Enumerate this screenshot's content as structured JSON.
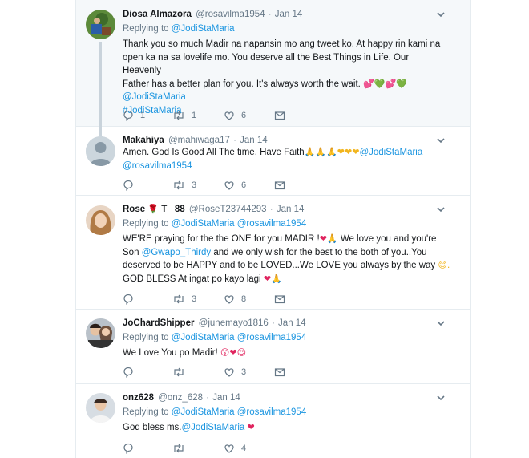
{
  "tweets": [
    {
      "name": "Diosa Almazora",
      "handle": "@rosavilma1954",
      "time": "Jan 14",
      "replying_label": "Replying to",
      "replying_to": [
        "@JodiStaMaria"
      ],
      "text_lines": [
        "Thank you so much Madir na napansin mo ang tweet ko. At happy rin kami na",
        "open ka na sa lovelife mo. You deserve all the Best Things in Life. Our Heavenly",
        "Father has a better plan for you. It's always worth the wait."
      ],
      "emojis_line3": "💕💚💕💚",
      "mention": "@JodiStaMaria",
      "hashtag": "#JodiStaMaria",
      "replies": "1",
      "retweets": "1",
      "likes": "6"
    },
    {
      "name": "Makahiya",
      "handle": "@mahiwaga17",
      "time": "Jan 14",
      "text_a": "Amen. God Is Good All The time. Have Faith",
      "emojis_a": "🙏🙏🙏❤❤❤",
      "mention_a": "@JodiStaMaria",
      "mention_b": "@rosavilma1954",
      "replies": "",
      "retweets": "3",
      "likes": "6"
    },
    {
      "name": "Rose",
      "name_emoji": "🌹",
      "name_rest": "T _88",
      "handle": "@RoseT23744293",
      "time": "Jan 14",
      "replying_label": "Replying to",
      "replying_to": [
        "@JodiStaMaria",
        "@rosavilma1954"
      ],
      "line1_a": "WE'RE praying for the the ONE for you MADIR !",
      "line1_emoji": "❤🙏",
      "line1_b": " We love you and you're",
      "line2_a": "Son ",
      "line2_mention": "@Gwapo_Thirdy",
      "line2_b": "  and we only wish for the best to the both of you..You",
      "line3": "deserved to be HAPPY  and  to be LOVED...We LOVE you always by the way",
      "line3_emoji": "😊.",
      "line4": "GOD BLESS At ingat po kayo lagi",
      "line4_emoji": "❤🙏",
      "replies": "",
      "retweets": "3",
      "likes": "8"
    },
    {
      "name": "JoChardShipper",
      "handle": "@junemayo1816",
      "time": "Jan 14",
      "replying_label": "Replying to",
      "replying_to": [
        "@JodiStaMaria",
        "@rosavilma1954"
      ],
      "text": "We Love You po Madir!",
      "emojis": "😙❤😍",
      "replies": "",
      "retweets": "",
      "likes": "3"
    },
    {
      "name": "onz628",
      "handle": "@onz_628",
      "time": "Jan 14",
      "replying_label": "Replying to",
      "replying_to": [
        "@JodiStaMaria",
        "@rosavilma1954"
      ],
      "text": "God bless ms.",
      "mention": "@JodiStaMaria",
      "emojis": "❤",
      "replies": "",
      "retweets": "",
      "likes": "4"
    }
  ],
  "colors": {
    "link": "#1b95e0",
    "muted": "#657786",
    "like": "#e0245e",
    "border": "#e6ecf0"
  }
}
